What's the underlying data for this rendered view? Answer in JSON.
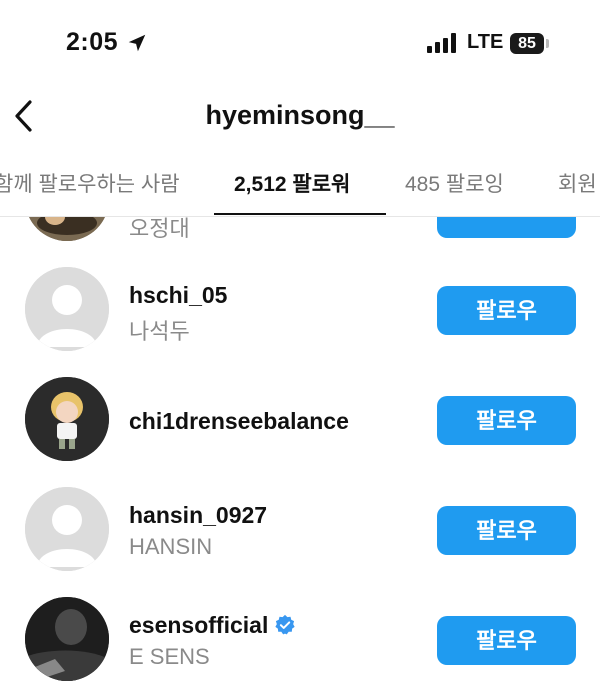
{
  "status_bar": {
    "time": "2:05",
    "network": "LTE",
    "battery": "85"
  },
  "header": {
    "title": "hyeminsong__"
  },
  "tabs": [
    {
      "label": "함께 팔로우하는 사람"
    },
    {
      "label": "2,512 팔로워"
    },
    {
      "label": "485 팔로잉"
    },
    {
      "label": "회원"
    }
  ],
  "followers": [
    {
      "username": "",
      "name": "오정대",
      "button": ""
    },
    {
      "username": "hschi_05",
      "name": "나석두",
      "button": "팔로우"
    },
    {
      "username": "chi1drenseebalance",
      "name": "",
      "button": "팔로우"
    },
    {
      "username": "hansin_0927",
      "name": "HANSIN",
      "button": "팔로우"
    },
    {
      "username": "esensofficial",
      "name": "E SENS",
      "button": "팔로우",
      "verified": true
    }
  ],
  "colors": {
    "accent": "#1f9bf0",
    "verified": "#3897f0"
  }
}
